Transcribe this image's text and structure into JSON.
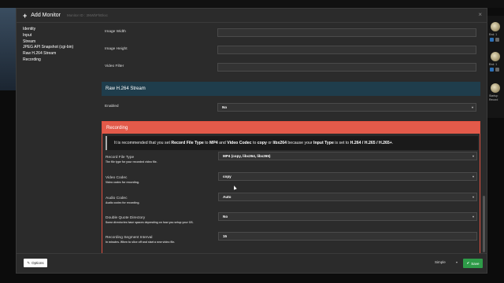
{
  "background": {
    "right_panel": {
      "labels": [
        "End: 1",
        "End: 1",
        "Startup",
        "Record"
      ]
    }
  },
  "modal": {
    "title": "Add Monitor",
    "subtitle": "Monitor ID : 3NWbFhEkxc",
    "close_icon": "×",
    "sidebar": {
      "items": [
        {
          "label": "Identity"
        },
        {
          "label": "Input"
        },
        {
          "label": "Stream"
        },
        {
          "label": "JPEG API Snapshot (cgi-bin)"
        },
        {
          "label": "Raw H.264 Stream"
        },
        {
          "label": "Recording"
        }
      ]
    },
    "fields_top": [
      {
        "label": "Image Width",
        "value": ""
      },
      {
        "label": "Image Height",
        "value": ""
      },
      {
        "label": "Video Filter",
        "value": ""
      }
    ],
    "raw_section": {
      "title": "Raw H.264 Stream",
      "enabled_label": "Enabled",
      "enabled_value": "No"
    },
    "recording_section": {
      "title": "Recording",
      "notice": {
        "t1": "It is recommended that you set ",
        "b1": "Record File Type",
        "t2": " to ",
        "b2": "MP4",
        "t3": " and ",
        "b3": "Video Codec",
        "t4": " to ",
        "b4": "copy",
        "t5": " or ",
        "b5": "libx264",
        "t6": " because your ",
        "b6": "Input Type",
        "t7": " is set to ",
        "b7": "H.264 / H.265 / H.265+",
        "t8": "."
      },
      "fields": [
        {
          "label": "Record File Type",
          "sub": "The file type for your recorded video file.",
          "value": "MP4 (copy, libx264, libx265)"
        },
        {
          "label": "Video Codec",
          "sub": "Video codec for recording.",
          "value": "copy"
        },
        {
          "label": "Audio Codec",
          "sub": "Audio codec for recording.",
          "value": "Auto"
        },
        {
          "label": "Double Quote Directory",
          "sub": "Some directories have spaces depending on how you setup your OS.",
          "value": "No"
        },
        {
          "label": "Recording Segment Interval",
          "sub": "In minutes. When to slice off and start a new video file.",
          "value": "15"
        }
      ]
    },
    "footer": {
      "options_label": "Options",
      "mode_label": "Simple",
      "save_label": "Save"
    }
  }
}
